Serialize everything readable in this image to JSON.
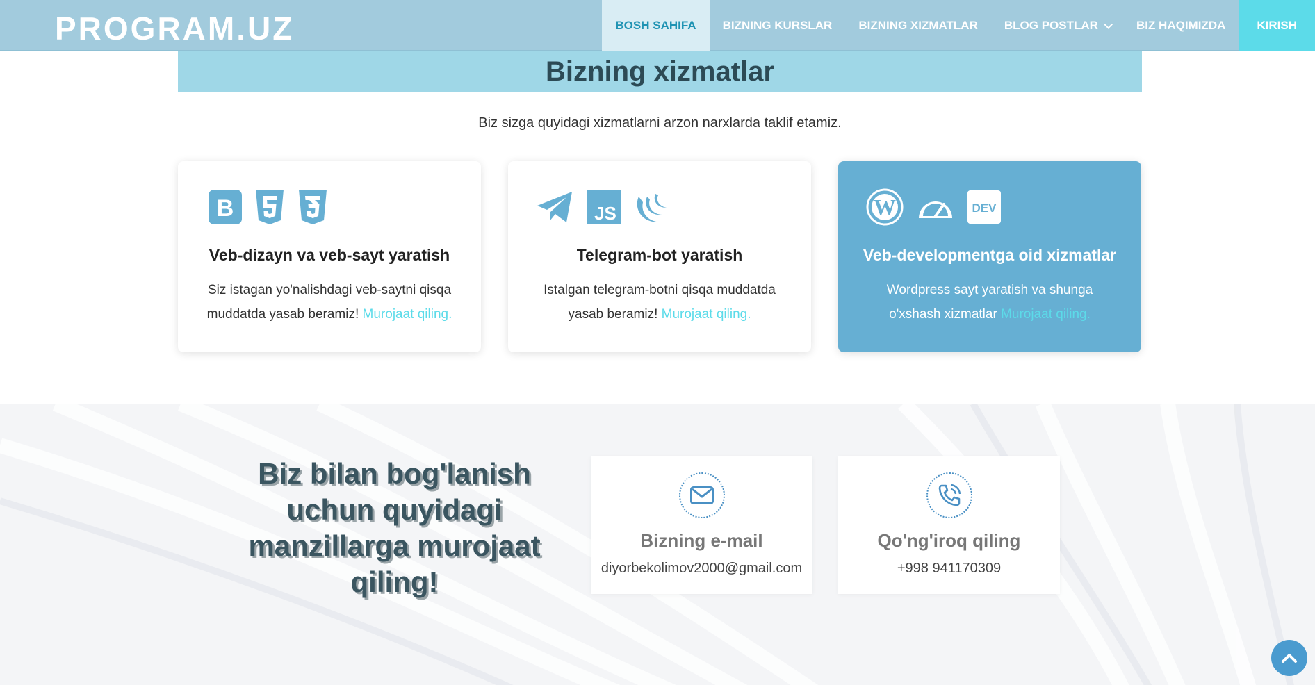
{
  "header": {
    "logo": "PROGRAM.UZ",
    "nav": [
      {
        "label": "BOSH SAHIFA"
      },
      {
        "label": "BIZNING KURSLAR"
      },
      {
        "label": "BIZNING XIZMATLAR"
      },
      {
        "label": "BLOG POSTLAR"
      },
      {
        "label": "BIZ HAQIMIZDA"
      },
      {
        "label": "KIRISH"
      }
    ]
  },
  "services": {
    "title": "Bizning xizmatlar",
    "subtitle": "Biz sizga quyidagi xizmatlarni arzon narxlarda taklif etamiz.",
    "cards": [
      {
        "icons": [
          "bootstrap-icon",
          "html5-icon",
          "css3-icon"
        ],
        "title": "Veb-dizayn va veb-sayt yaratish",
        "text": "Siz istagan yo'nalishdagi veb-saytni qisqa muddatda yasab beramiz!",
        "link": "Murojaat qiling."
      },
      {
        "icons": [
          "telegram-icon",
          "js-icon",
          "jquery-icon"
        ],
        "title": "Telegram-bot yaratish",
        "text": "Istalgan telegram-botni qisqa muddatda yasab beramiz!",
        "link": "Murojaat qiling."
      },
      {
        "icons": [
          "wordpress-icon",
          "speedometer-icon",
          "dev-icon"
        ],
        "title": "Veb-developmentga oid xizmatlar",
        "text": "Wordpress sayt yaratish va shunga o'xshash xizmatlar",
        "link": "Murojaat qiling."
      }
    ]
  },
  "contact": {
    "heading": "Biz bilan bog'lanish uchun quyidagi manzillarga murojaat qiling!",
    "email": {
      "title": "Bizning e-mail",
      "value": "diyorbekolimov2000@gmail.com",
      "icon": "envelope-icon"
    },
    "phone": {
      "title": "Qo'ng'iroq qiling",
      "value": "+998 941170309",
      "icon": "phone-icon"
    }
  },
  "colors": {
    "header_bg": "#a2cbdd",
    "accent": "#5cdbe9",
    "card_highlight": "#66afd3",
    "title_bar": "#9fd7e7"
  }
}
